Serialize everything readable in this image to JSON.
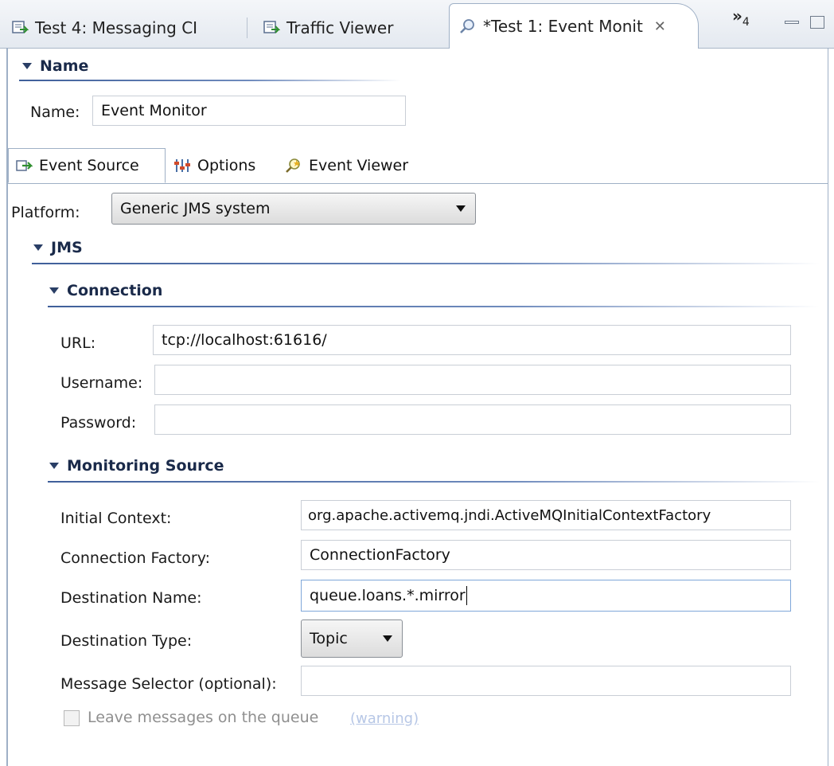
{
  "tabs": [
    {
      "label": "Test 4: Messaging CI",
      "icon": "test-suite-icon"
    },
    {
      "label": "Traffic Viewer",
      "icon": "test-suite-icon"
    },
    {
      "label": "*Test 1: Event Monit",
      "icon": "search-icon",
      "active": true
    }
  ],
  "overflow": {
    "marker": "»",
    "count": "4"
  },
  "name_section": {
    "title": "Name",
    "name_label": "Name:",
    "name_value": "Event Monitor"
  },
  "subtabs": [
    {
      "label": "Event Source",
      "icon": "event-source-icon",
      "selected": true
    },
    {
      "label": "Options",
      "icon": "options-icon"
    },
    {
      "label": "Event Viewer",
      "icon": "event-viewer-icon"
    }
  ],
  "platform": {
    "label": "Platform:",
    "value": "Generic JMS system"
  },
  "jms": {
    "title": "JMS"
  },
  "connection": {
    "title": "Connection",
    "url_label": "URL:",
    "url_value": "tcp://localhost:61616/",
    "username_label": "Username:",
    "username_value": "",
    "password_label": "Password:",
    "password_value": ""
  },
  "monitoring": {
    "title": "Monitoring Source",
    "initial_context_label": "Initial Context:",
    "initial_context_value": "org.apache.activemq.jndi.ActiveMQInitialContextFactory",
    "connection_factory_label": "Connection Factory:",
    "connection_factory_value": "ConnectionFactory",
    "destination_name_label": "Destination Name:",
    "destination_name_value": "queue.loans.*.mirror",
    "destination_type_label": "Destination Type:",
    "destination_type_value": "Topic",
    "message_selector_label": "Message Selector (optional):",
    "message_selector_value": "",
    "leave_messages_label": "Leave messages on the queue",
    "warning_link": "(warning)"
  }
}
